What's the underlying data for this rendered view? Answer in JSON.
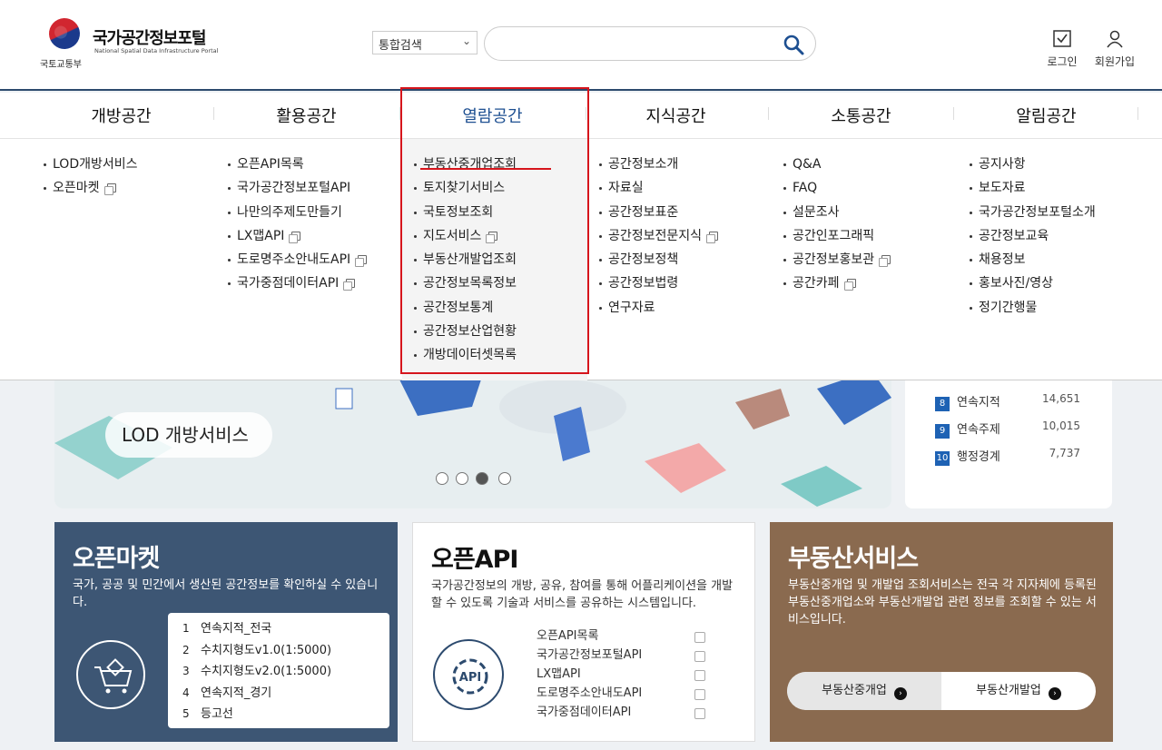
{
  "header": {
    "title": "국가공간정보포털",
    "subtitle": "National Spatial Data Infrastructure Portal",
    "org": "국토교통부",
    "search_select": "통합검색",
    "search_value": "",
    "login": "로그인",
    "signup": "회원가입"
  },
  "nav": {
    "categories": [
      "개방공간",
      "활용공간",
      "열람공간",
      "지식공간",
      "소통공간",
      "알림공간"
    ],
    "col1": [
      "LOD개방서비스",
      "오픈마켓"
    ],
    "col2": [
      "오픈API목록",
      "국가공간정보포털API",
      "나만의주제도만들기",
      "LX맵API",
      "도로명주소안내도API",
      "국가중점데이터API"
    ],
    "col3": [
      "부동산중개업조회",
      "토지찾기서비스",
      "국토정보조회",
      "지도서비스",
      "부동산개발업조회",
      "공간정보목록정보",
      "공간정보통계",
      "공간정보산업현황",
      "개방데이터셋목록"
    ],
    "col4": [
      "공간정보소개",
      "자료실",
      "공간정보표준",
      "공간정보전문지식",
      "공간정보정책",
      "공간정보법령",
      "연구자료"
    ],
    "col5": [
      "Q&A",
      "FAQ",
      "설문조사",
      "공간인포그래픽",
      "공간정보홍보관",
      "공간카페"
    ],
    "col6": [
      "공지사항",
      "보도자료",
      "국가공간정보포털소개",
      "공간정보교육",
      "채용정보",
      "홍보사진/영상",
      "정기간행물"
    ]
  },
  "banner": {
    "label": "LOD 개방서비스",
    "slide_active": 3,
    "slide_count": 4
  },
  "ranking": [
    {
      "num": "8",
      "name": "연속지적",
      "count": "14,651"
    },
    {
      "num": "9",
      "name": "연속주제",
      "count": "10,015"
    },
    {
      "num": "10",
      "name": "행정경계",
      "count": "7,737"
    }
  ],
  "openmarket": {
    "title": "오픈마켓",
    "desc": "국가, 공공 및 민간에서 생산된 공간정보를 확인하실 수 있습니다.",
    "items": [
      {
        "n": "1",
        "label": "연속지적_전국"
      },
      {
        "n": "2",
        "label": "수치지형도v1.0(1:5000)"
      },
      {
        "n": "3",
        "label": "수치지형도v2.0(1:5000)"
      },
      {
        "n": "4",
        "label": "연속지적_경기"
      },
      {
        "n": "5",
        "label": "등고선"
      }
    ]
  },
  "openapi": {
    "title": "오픈API",
    "desc": "국가공간정보의 개방, 공유, 참여를 통해 어플리케이션을 개발할 수 있도록 기술과 서비스를 공유하는 시스템입니다.",
    "items": [
      "오픈API목록",
      "국가공간정보포털API",
      "LX맵API",
      "도로명주소안내도API",
      "국가중점데이터API"
    ],
    "icon_text": "API"
  },
  "realestate": {
    "title": "부동산서비스",
    "desc": "부동산중개업 및 개발업 조회서비스는 전국 각 지자체에 등록된 부동산중개업소와 부동산개발업 관련 정보를 조회할 수 있는 서비스입니다.",
    "btn1": "부동산중개업",
    "btn2": "부동산개발업"
  }
}
